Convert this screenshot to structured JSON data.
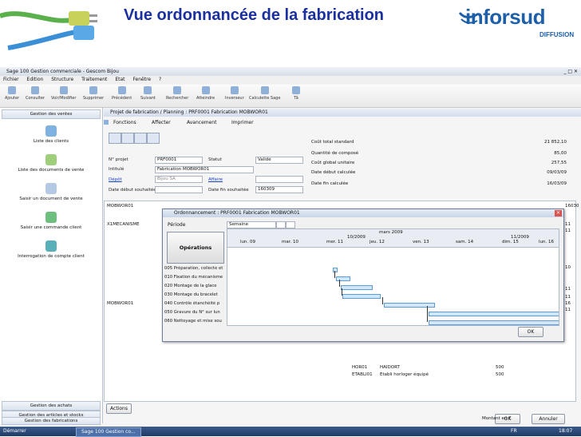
{
  "slide": {
    "title": "Vue ordonnancée de la fabrication",
    "brand": "inforsud",
    "brand_sub": "DIFFUSION"
  },
  "window": {
    "title": "Sage 100 Gestion commerciale - Gescom Bijou"
  },
  "menu": [
    "Fichier",
    "Edition",
    "Structure",
    "Traitement",
    "Etat",
    "Fenêtre",
    "?"
  ],
  "toolbar": [
    "Ajouter",
    "Consulter",
    "Voir/Modifier",
    "Supprimer",
    "Précédent",
    "Suivant",
    "Rechercher",
    "Atteindre",
    "Inverseur",
    "Calculette Sage",
    "Tâ"
  ],
  "sidebar": {
    "top_section": "Gestion des ventes",
    "tasks": [
      "Liste des clients",
      "Liste des documents de vente",
      "Saisir un document de vente",
      "Saisir une commande client",
      "Interrogation de compte client"
    ],
    "bottom_sections": [
      "Gestion des achats",
      "Gestion des articles et stocks",
      "Gestion des fabrications"
    ]
  },
  "form": {
    "title": "Projet de fabrication / Planning : PRF0001 Fabrication MOBWOR01",
    "actions": [
      "Fonctions",
      "Affecter",
      "Avancement",
      "Imprimer"
    ],
    "fields": {
      "no_projet_label": "N° projet",
      "no_projet": "PRF0001",
      "statut_label": "Statut",
      "statut": "Validé",
      "intitule_label": "Intitulé",
      "intitule": "Fabrication MOBWOR01",
      "depot_label": "Dépôt",
      "depot": "Bijou SA",
      "affaire_label": "Affaire",
      "date_debut_label": "Date début souhaitée",
      "date_fin_label": "Date fin souhaitée",
      "date_fin": "160309"
    },
    "stats": [
      {
        "label": "Coût total standard",
        "value": "21 852,10"
      },
      {
        "label": "Quantité de composé",
        "value": "85,00"
      },
      {
        "label": "Coût global unitaire",
        "value": "257,55"
      },
      {
        "label": "Date début calculée",
        "value": "09/03/09"
      },
      {
        "label": "Date fin calculée",
        "value": "16/03/09"
      }
    ],
    "grid_labels": {
      "row1": "MOBWOR01",
      "row2": "X1MECANISME",
      "row3": "MOBWOR01",
      "right_col_head": "16030",
      "right_values": [
        "11",
        "11",
        "10",
        "11",
        "11",
        "16",
        "11"
      ]
    },
    "items": [
      {
        "code": "HOR01",
        "desc": "HAIDORT",
        "qty": "500"
      },
      {
        "code": "ETABLI01",
        "desc": "Etabli horloger équipé",
        "qty": "500"
      }
    ],
    "footer": {
      "actions_button": "Actions",
      "ok_button": "OK",
      "cancel_button": "Annuler",
      "montant": "Montant en €"
    }
  },
  "dialog": {
    "title": "Ordonnancement : PRF0001 Fabrication MOBWOR01",
    "periode_label": "Période",
    "periode_value": "Semaine",
    "operations_button": "Opérations",
    "month_label": "mars 2009",
    "week_left": "10/2009",
    "week_right": "11/2009",
    "days": [
      "lun. 09",
      "mar. 10",
      "mer. 11",
      "jeu. 12",
      "ven. 13",
      "sam. 14",
      "dim. 15",
      "lun. 16"
    ],
    "tasks": [
      "005 Préparation, collecte et tri",
      "010 Fixation du mécanisme",
      "020 Montage de la glace",
      "030 Montage du bracelet",
      "040 Contrôle étanchéité p",
      "050 Gravure du N° sur lun",
      "060 Nettoyage et mise sou"
    ],
    "ok_button": "OK"
  },
  "statusbar": {
    "start": "Démarrer",
    "task": "Sage 100 Gestion co...",
    "lang": "FR",
    "clock": "18:07"
  }
}
